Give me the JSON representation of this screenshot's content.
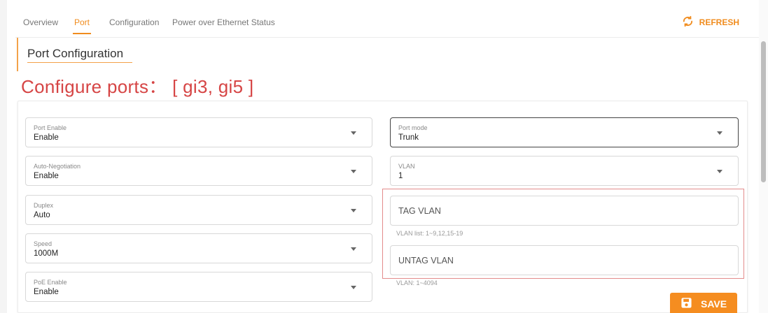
{
  "tabs": [
    {
      "label": "Overview"
    },
    {
      "label": "Port"
    },
    {
      "label": "Configuration"
    },
    {
      "label": "Power over Ethernet Status"
    }
  ],
  "active_tab": "Port",
  "refresh_label": "REFRESH",
  "section_title": "Port Configuration",
  "configure_heading": "Configure ports： [ gi3, gi5 ]",
  "left_fields": [
    {
      "label": "Port Enable",
      "value": "Enable"
    },
    {
      "label": "Auto-Negotiation",
      "value": "Enable"
    },
    {
      "label": "Duplex",
      "value": "Auto"
    },
    {
      "label": "Speed",
      "value": "1000M"
    },
    {
      "label": "PoE Enable",
      "value": "Enable"
    }
  ],
  "right_fields": [
    {
      "label": "Port mode",
      "value": "Trunk"
    },
    {
      "label": "VLAN",
      "value": "1"
    }
  ],
  "tag_vlan": {
    "placeholder": "TAG VLAN",
    "value": "",
    "helper": "VLAN list: 1~9,12,15-19"
  },
  "untag_vlan": {
    "placeholder": "UNTAG VLAN",
    "value": "",
    "helper": "VLAN: 1~4094"
  },
  "save_label": "SAVE",
  "colors": {
    "accent": "#f08c1e",
    "heading": "#d64545",
    "highlight_box": "#e38b8b"
  }
}
